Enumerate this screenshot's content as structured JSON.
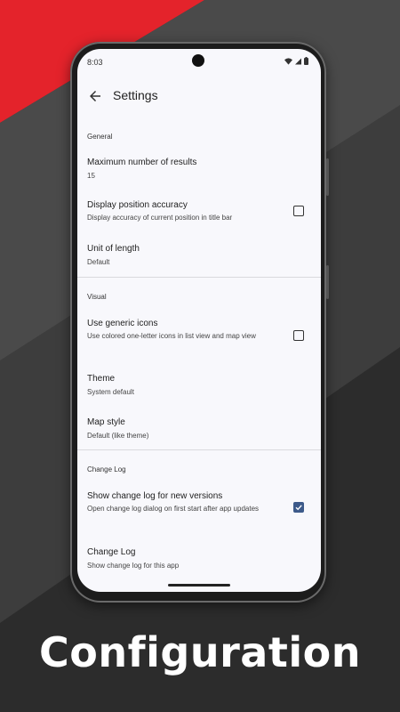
{
  "status": {
    "time": "8:03"
  },
  "app": {
    "title": "Settings"
  },
  "sections": {
    "general": "General",
    "visual": "Visual",
    "changelog": "Change Log"
  },
  "items": {
    "max_results": {
      "title": "Maximum number of results",
      "summary": "15"
    },
    "position_accuracy": {
      "title": "Display position accuracy",
      "summary": "Display accuracy of current position in title bar",
      "checked": false
    },
    "unit_length": {
      "title": "Unit of length",
      "summary": "Default"
    },
    "generic_icons": {
      "title": "Use generic icons",
      "summary": "Use colored one-letter icons in list view and map view",
      "checked": false
    },
    "theme": {
      "title": "Theme",
      "summary": "System default"
    },
    "map_style": {
      "title": "Map style",
      "summary": "Default (like theme)"
    },
    "show_changelog": {
      "title": "Show change log for new versions",
      "summary": "Open change log dialog on first start after app updates",
      "checked": true
    },
    "changelog": {
      "title": "Change Log",
      "summary": "Show change log for this app"
    }
  },
  "caption": "Configuration",
  "colors": {
    "accent_red": "#e4232b",
    "checkbox_checked": "#3d5a8a",
    "background": "#3d3d3d"
  }
}
